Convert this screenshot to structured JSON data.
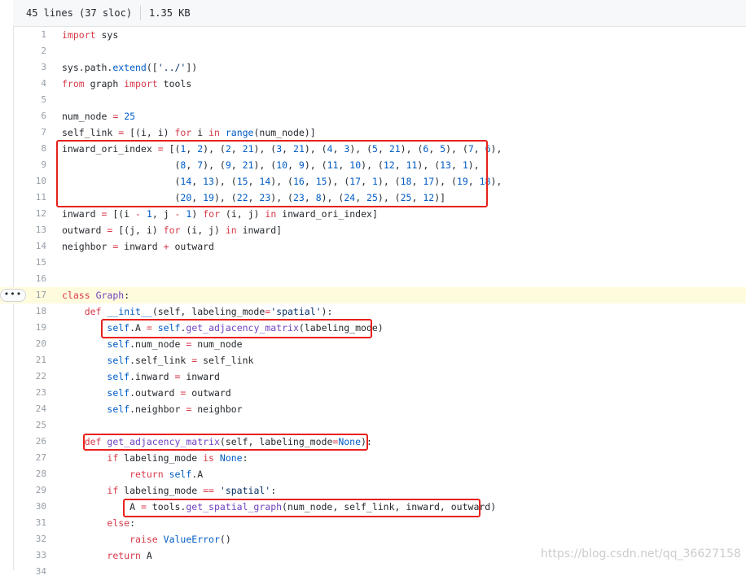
{
  "header": {
    "lines_info": "45 lines (37 sloc)",
    "size": "1.35 KB"
  },
  "fold_button_label": "•••",
  "code_lines": [
    {
      "n": "1",
      "html": "<span class=\"k\">import</span> sys"
    },
    {
      "n": "2",
      "html": ""
    },
    {
      "n": "3",
      "html": "sys.path.<span class=\"n\">extend</span>([<span class=\"s\">'../'</span>])"
    },
    {
      "n": "4",
      "html": "<span class=\"k\">from</span> graph <span class=\"k\">import</span> tools"
    },
    {
      "n": "5",
      "html": ""
    },
    {
      "n": "6",
      "html": "num_node <span class=\"k\">=</span> <span class=\"n\">25</span>"
    },
    {
      "n": "7",
      "html": "self_link <span class=\"k\">=</span> [(i, i) <span class=\"k\">for</span> i <span class=\"k\">in</span> <span class=\"n\">range</span>(num_node)]"
    },
    {
      "n": "8",
      "html": "inward_ori_index <span class=\"k\">=</span> [(<span class=\"n\">1</span>, <span class=\"n\">2</span>), (<span class=\"n\">2</span>, <span class=\"n\">21</span>), (<span class=\"n\">3</span>, <span class=\"n\">21</span>), (<span class=\"n\">4</span>, <span class=\"n\">3</span>), (<span class=\"n\">5</span>, <span class=\"n\">21</span>), (<span class=\"n\">6</span>, <span class=\"n\">5</span>), (<span class=\"n\">7</span>, <span class=\"n\">6</span>),"
    },
    {
      "n": "9",
      "html": "                    (<span class=\"n\">8</span>, <span class=\"n\">7</span>), (<span class=\"n\">9</span>, <span class=\"n\">21</span>), (<span class=\"n\">10</span>, <span class=\"n\">9</span>), (<span class=\"n\">11</span>, <span class=\"n\">10</span>), (<span class=\"n\">12</span>, <span class=\"n\">11</span>), (<span class=\"n\">13</span>, <span class=\"n\">1</span>),"
    },
    {
      "n": "10",
      "html": "                    (<span class=\"n\">14</span>, <span class=\"n\">13</span>), (<span class=\"n\">15</span>, <span class=\"n\">14</span>), (<span class=\"n\">16</span>, <span class=\"n\">15</span>), (<span class=\"n\">17</span>, <span class=\"n\">1</span>), (<span class=\"n\">18</span>, <span class=\"n\">17</span>), (<span class=\"n\">19</span>, <span class=\"n\">18</span>),"
    },
    {
      "n": "11",
      "html": "                    (<span class=\"n\">20</span>, <span class=\"n\">19</span>), (<span class=\"n\">22</span>, <span class=\"n\">23</span>), (<span class=\"n\">23</span>, <span class=\"n\">8</span>), (<span class=\"n\">24</span>, <span class=\"n\">25</span>), (<span class=\"n\">25</span>, <span class=\"n\">12</span>)]"
    },
    {
      "n": "12",
      "html": "inward <span class=\"k\">=</span> [(i <span class=\"k\">-</span> <span class=\"n\">1</span>, j <span class=\"k\">-</span> <span class=\"n\">1</span>) <span class=\"k\">for</span> (i, j) <span class=\"k\">in</span> inward_ori_index]"
    },
    {
      "n": "13",
      "html": "outward <span class=\"k\">=</span> [(j, i) <span class=\"k\">for</span> (i, j) <span class=\"k\">in</span> inward]"
    },
    {
      "n": "14",
      "html": "neighbor <span class=\"k\">=</span> inward <span class=\"k\">+</span> outward"
    },
    {
      "n": "15",
      "html": ""
    },
    {
      "n": "16",
      "html": ""
    },
    {
      "n": "17",
      "html": "<span class=\"k\">class</span> <span class=\"f\">Graph</span>:",
      "hl": true
    },
    {
      "n": "18",
      "html": "    <span class=\"k\">def</span> <span class=\"n\">__init__</span>(self, labeling_mode<span class=\"k\">=</span><span class=\"s\">'spatial'</span>):"
    },
    {
      "n": "19",
      "html": "        <span class=\"n\">self</span>.A <span class=\"k\">=</span> <span class=\"n\">self</span>.<span class=\"f\">get_adjacency_matrix</span>(labeling_mode)"
    },
    {
      "n": "20",
      "html": "        <span class=\"n\">self</span>.num_node <span class=\"k\">=</span> num_node"
    },
    {
      "n": "21",
      "html": "        <span class=\"n\">self</span>.self_link <span class=\"k\">=</span> self_link"
    },
    {
      "n": "22",
      "html": "        <span class=\"n\">self</span>.inward <span class=\"k\">=</span> inward"
    },
    {
      "n": "23",
      "html": "        <span class=\"n\">self</span>.outward <span class=\"k\">=</span> outward"
    },
    {
      "n": "24",
      "html": "        <span class=\"n\">self</span>.neighbor <span class=\"k\">=</span> neighbor"
    },
    {
      "n": "25",
      "html": ""
    },
    {
      "n": "26",
      "html": "    <span class=\"k\">def</span> <span class=\"f\">get_adjacency_matrix</span>(self, labeling_mode<span class=\"k\">=</span><span class=\"n\">None</span>):"
    },
    {
      "n": "27",
      "html": "        <span class=\"k\">if</span> labeling_mode <span class=\"k\">is</span> <span class=\"n\">None</span>:"
    },
    {
      "n": "28",
      "html": "            <span class=\"k\">return</span> <span class=\"n\">self</span>.A"
    },
    {
      "n": "29",
      "html": "        <span class=\"k\">if</span> labeling_mode <span class=\"k\">==</span> <span class=\"s\">'spatial'</span>:"
    },
    {
      "n": "30",
      "html": "            A <span class=\"k\">=</span> tools.<span class=\"f\">get_spatial_graph</span>(num_node, self_link, inward, outward)"
    },
    {
      "n": "31",
      "html": "        <span class=\"k\">else</span>:"
    },
    {
      "n": "32",
      "html": "            <span class=\"k\">raise</span> <span class=\"n\">ValueError</span>()"
    },
    {
      "n": "33",
      "html": "        <span class=\"k\">return</span> A"
    },
    {
      "n": "34",
      "html": ""
    }
  ],
  "watermark": "https://blog.csdn.net/qq_36627158",
  "colors": {
    "keyword": "#d73a49",
    "constant": "#005cc5",
    "string": "#032f62",
    "function": "#6f42c1",
    "highlight_line": "#fffbdd",
    "annotation_box": "#e8211b"
  }
}
